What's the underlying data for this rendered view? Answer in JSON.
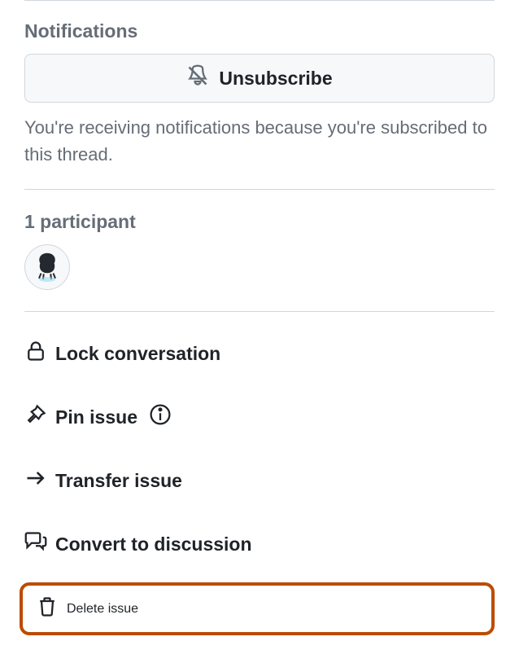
{
  "notifications": {
    "heading": "Notifications",
    "unsubscribe_label": "Unsubscribe",
    "explanation": "You're receiving notifications because you're subscribed to this thread."
  },
  "participants": {
    "heading": "1 participant"
  },
  "actions": {
    "lock": "Lock conversation",
    "pin": "Pin issue",
    "transfer": "Transfer issue",
    "convert": "Convert to discussion",
    "delete": "Delete issue"
  },
  "colors": {
    "highlight": "#bc4c00",
    "text_muted": "#656d76",
    "border": "#d0d7de"
  }
}
